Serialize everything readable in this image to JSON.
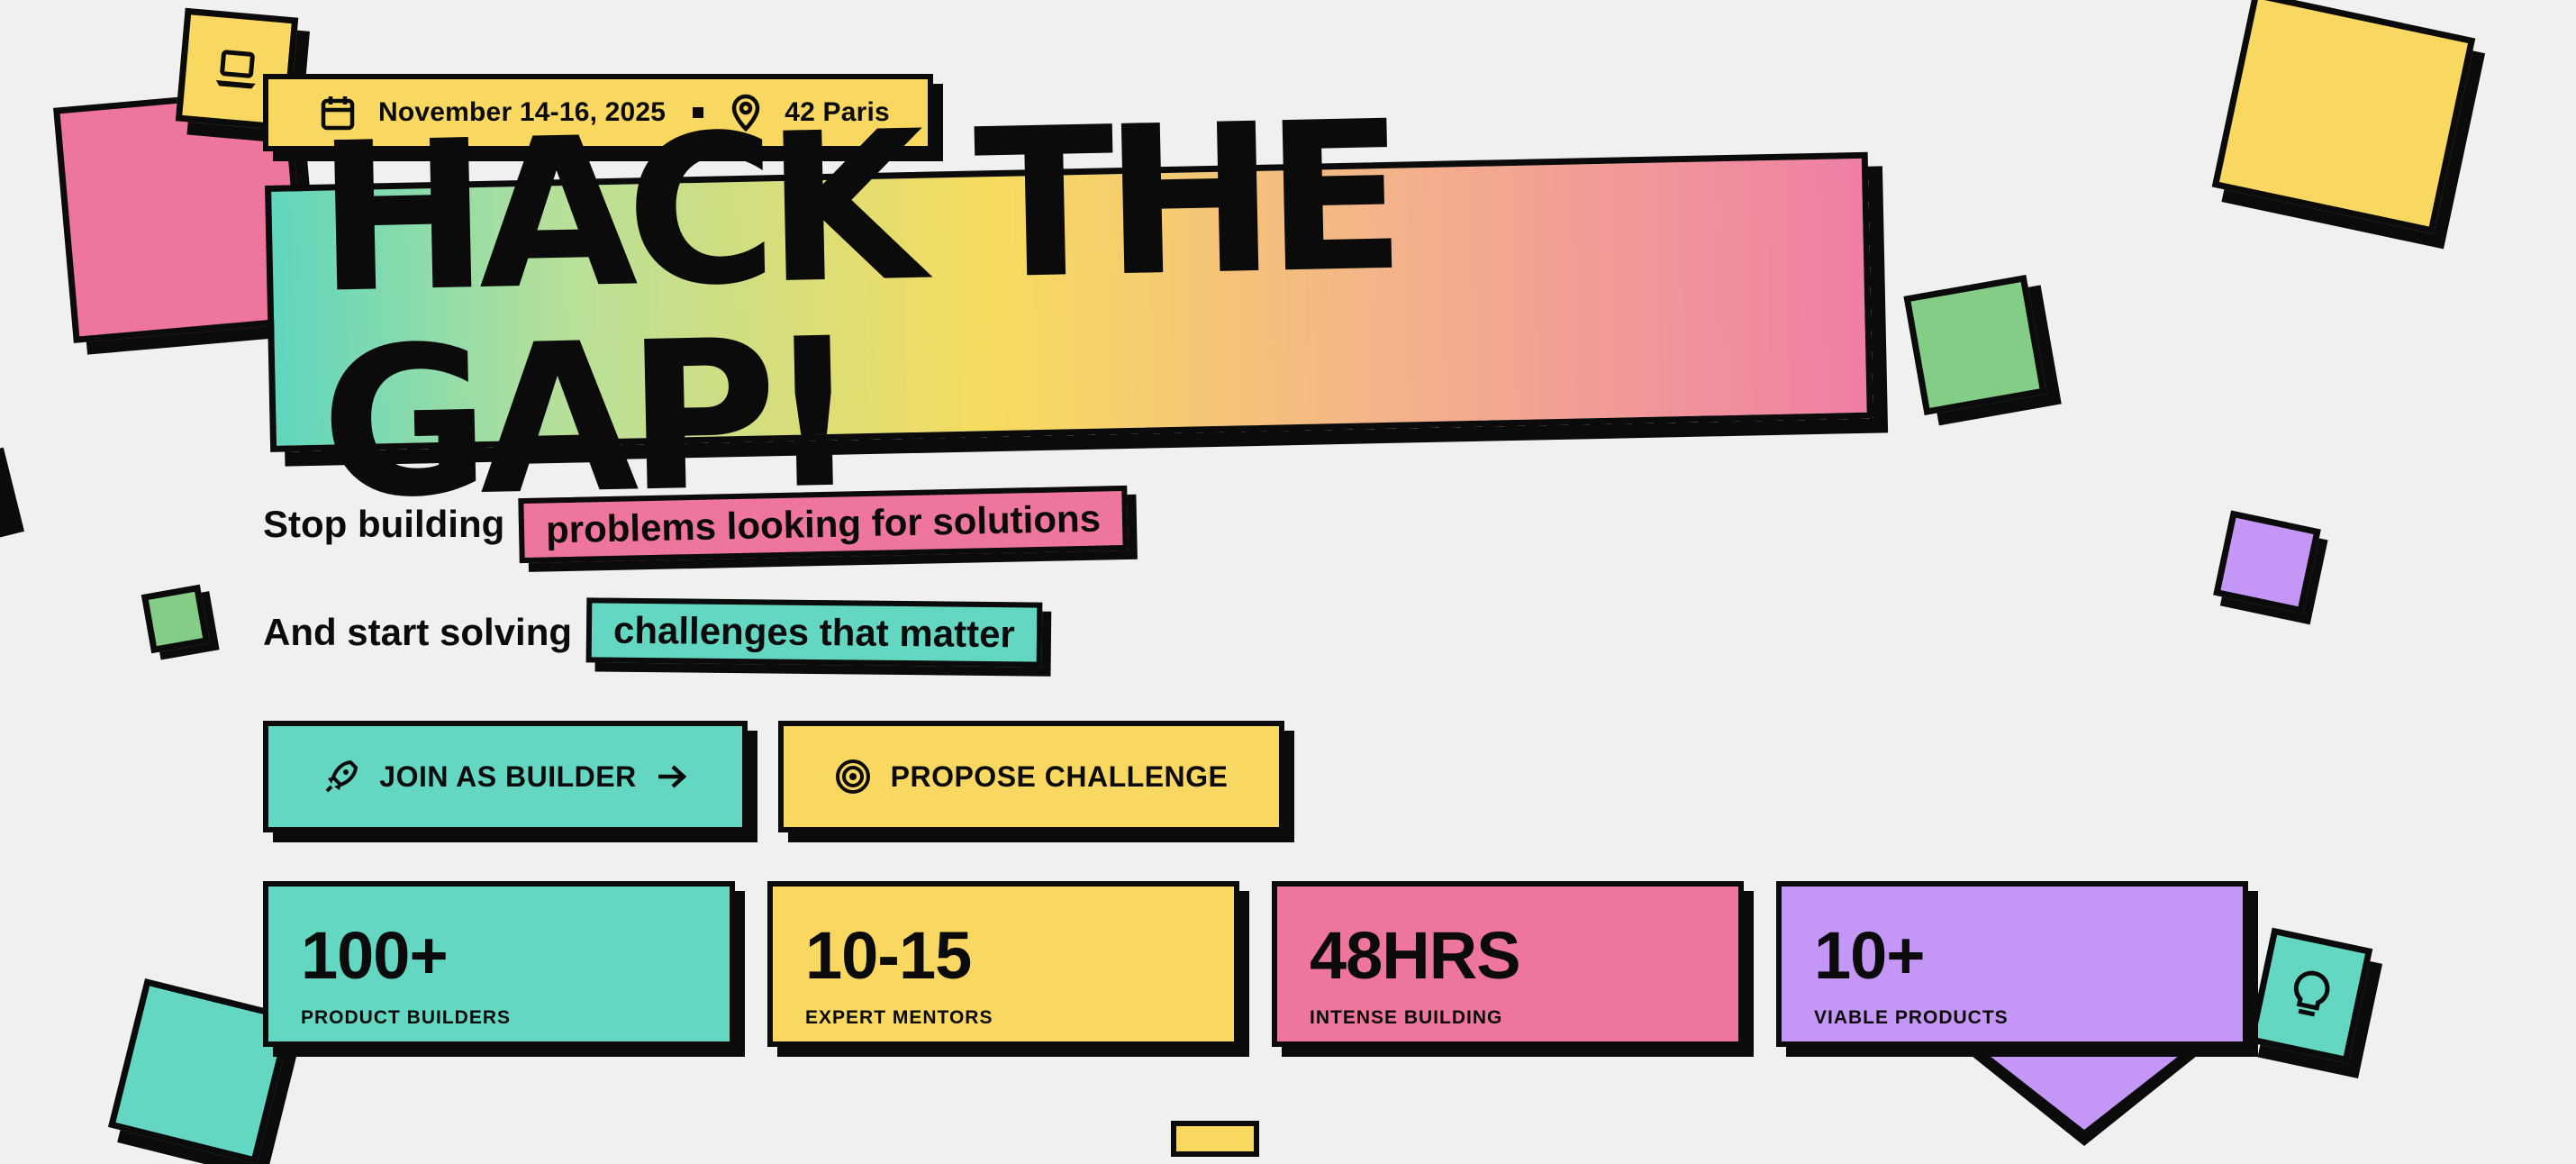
{
  "event": {
    "date": "November 14-16, 2025",
    "location": "42 Paris"
  },
  "hero": {
    "title": "HACK THE GAP!"
  },
  "tagline": {
    "line1_prefix": "Stop building",
    "line1_highlight": "problems looking for solutions",
    "line2_prefix": "And start solving",
    "line2_highlight": "challenges that matter"
  },
  "actions": {
    "join_label": "JOIN AS BUILDER",
    "propose_label": "PROPOSE CHALLENGE"
  },
  "stats": [
    {
      "value": "100+",
      "label": "PRODUCT BUILDERS"
    },
    {
      "value": "10-15",
      "label": "EXPERT MENTORS"
    },
    {
      "value": "48HRS",
      "label": "INTENSE BUILDING"
    },
    {
      "value": "10+",
      "label": "VIABLE PRODUCTS"
    }
  ],
  "colors": {
    "teal": "#63d7c1",
    "yellow": "#f8d860",
    "pink": "#ee769d",
    "purple": "#c497f6",
    "green": "#84cd87",
    "background": "#f0f0f0",
    "ink": "#0b0b0b"
  },
  "icons": {
    "date": "calendar-icon",
    "location": "map-pin-icon",
    "join": "rocket-icon",
    "propose": "target-icon",
    "laptop": "laptop-icon",
    "idea": "lightbulb-icon",
    "arrow": "arrow-right-icon"
  }
}
